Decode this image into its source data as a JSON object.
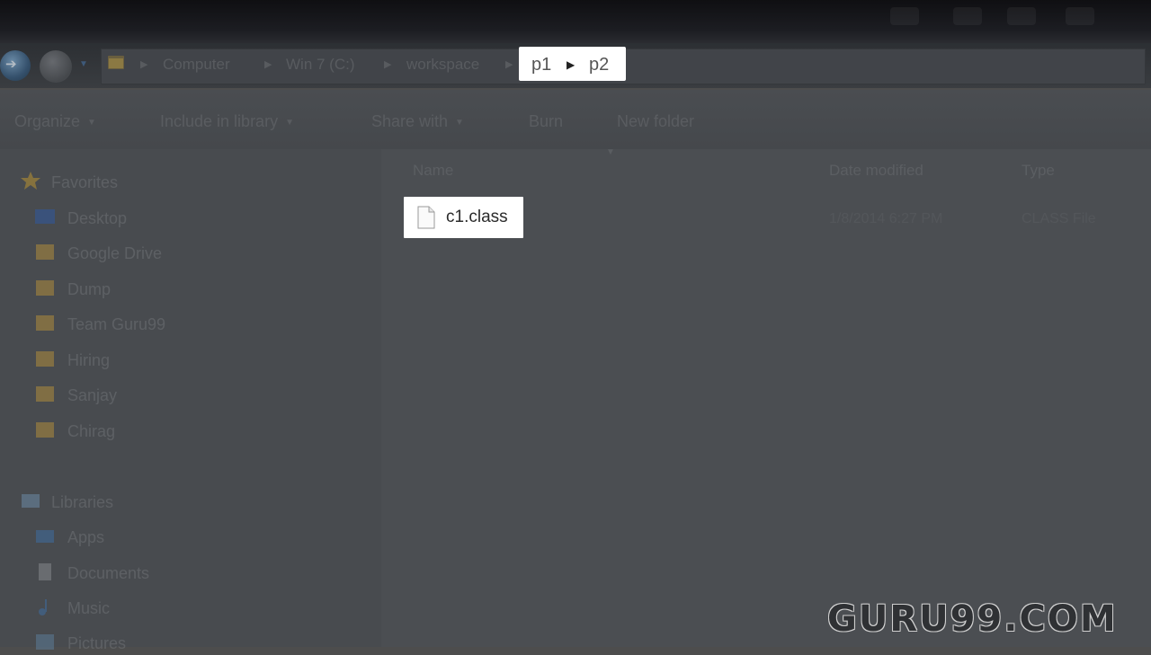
{
  "breadcrumb": {
    "items": [
      "Computer",
      "Win 7 (C:)",
      "workspace",
      "p1",
      "p2"
    ]
  },
  "toolbar": {
    "organize": "Organize",
    "include_in_library": "Include in library",
    "share_with": "Share with",
    "burn": "Burn",
    "new_folder": "New folder"
  },
  "navigation": {
    "favorites": {
      "header": "Favorites",
      "items": [
        "Desktop",
        "Google Drive",
        "Dump",
        "Team Guru99",
        "Hiring",
        "Sanjay",
        "Chirag"
      ]
    },
    "libraries": {
      "header": "Libraries",
      "items": [
        "Apps",
        "Documents",
        "Music",
        "Pictures"
      ]
    }
  },
  "columns": {
    "name": "Name",
    "date_modified": "Date modified",
    "type": "Type"
  },
  "files": [
    {
      "name": "c1.class",
      "date_modified": "1/8/2014 6:27 PM",
      "type": "CLASS File",
      "icon": "blank-file-icon"
    }
  ],
  "watermark": "GURU99.COM",
  "colors": {
    "highlight": "#ffffff",
    "dim_overlay": "#4d4d4d",
    "folder": "#b8923a"
  }
}
